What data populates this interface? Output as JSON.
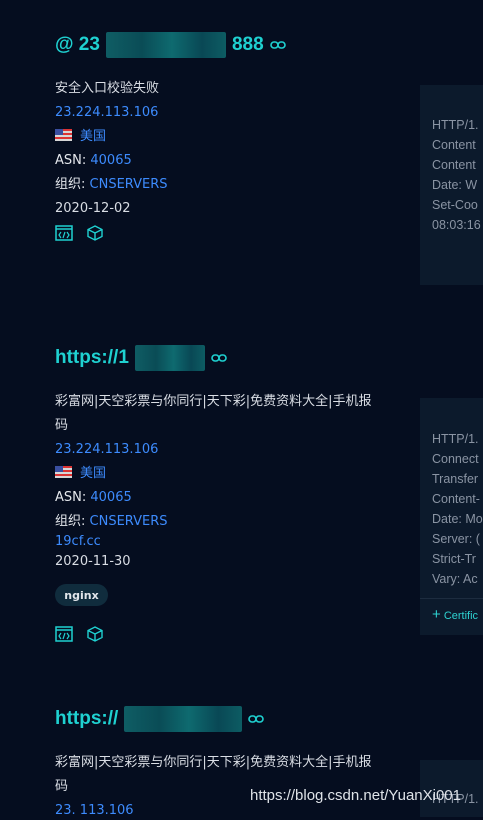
{
  "results": [
    {
      "host_prefix": "@ 23",
      "host_suffix": "888",
      "title": "安全入口校验失败",
      "ip": "23.224.113.106",
      "country": "美国",
      "asn_label": "ASN:",
      "asn": "40065",
      "org_label": "组织:",
      "org": "CNSERVERS",
      "date": "2020-12-02",
      "response_lines": [
        "HTTP/1.",
        "Content",
        "Content",
        "Date: W",
        "Set-Coo",
        "08:03:16"
      ]
    },
    {
      "host_prefix": "https://1",
      "title_line1": "彩富网|天空彩票与你同行|天下彩|免费资料大全|手机报",
      "title_line2": "码",
      "ip": "23.224.113.106",
      "country": "美国",
      "asn_label": "ASN:",
      "asn": "40065",
      "org_label": "组织:",
      "org": "CNSERVERS",
      "domain": "19cf.cc",
      "date": "2020-11-30",
      "tag": "nginx",
      "response_lines": [
        "HTTP/1.",
        "Connect",
        "Transfer",
        "Content-",
        "Date: Mo",
        "Server: (",
        "Strict-Tr",
        "Vary: Ac"
      ],
      "cert_label": "Certific"
    },
    {
      "host_prefix": "https://",
      "title_line1": "彩富网|天空彩票与你同行|天下彩|免费资料大全|手机报",
      "title_line2": "码",
      "ip_partial": "23.  113.106",
      "response_lines": [
        "HTTP/1."
      ]
    }
  ],
  "watermark": "https://blog.csdn.net/YuanXi001",
  "icons": [
    "code-icon",
    "cube-icon",
    "link-icon",
    "us-flag-icon",
    "plus-icon"
  ],
  "colors": {
    "background": "#050d1f",
    "accent": "#1fd1d1",
    "link": "#3d8bfd"
  }
}
